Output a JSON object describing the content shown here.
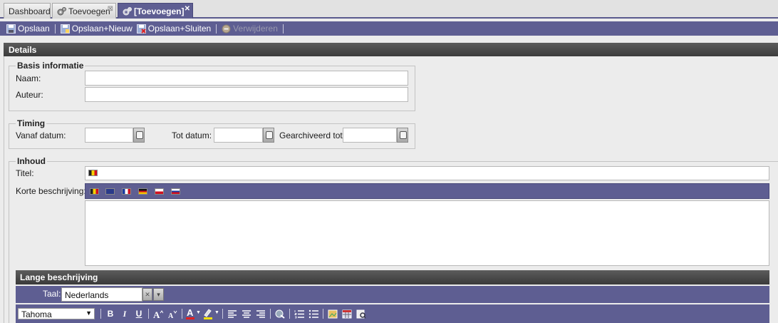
{
  "tabs": [
    {
      "label": "Dashboard",
      "closable": false,
      "active": false
    },
    {
      "label": "Toevoegen",
      "closable": true,
      "active": false
    },
    {
      "label": "[Toevoegen]",
      "closable": true,
      "active": true
    }
  ],
  "toolbar": {
    "save": "Opslaan",
    "save_new": "Opslaan+Nieuw",
    "save_close": "Opslaan+Sluiten",
    "delete": "Verwijderen"
  },
  "details": {
    "title": "Details",
    "basis": {
      "legend": "Basis informatie",
      "naam_label": "Naam:",
      "naam_value": "",
      "auteur_label": "Auteur:",
      "auteur_value": ""
    },
    "timing": {
      "legend": "Timing",
      "vanaf_label": "Vanaf datum:",
      "tot_label": "Tot datum:",
      "gearchiveerd_label": "Gearchiveerd tot:",
      "vanaf_value": "",
      "tot_value": "",
      "gearchiveerd_value": ""
    },
    "inhoud": {
      "legend": "Inhoud",
      "titel_label": "Titel:",
      "titel_value": "",
      "korte_label": "Korte beschrijving:",
      "korte_value": "",
      "flags": [
        "flag-be-icon",
        "flag-uk-icon",
        "flag-fr-icon",
        "flag-de-icon",
        "flag-cz-icon",
        "flag-sk-icon"
      ]
    }
  },
  "lange": {
    "title": "Lange beschrijving",
    "taal_label": "Taal:",
    "taal_value": "Nederlands",
    "font_value": "Tahoma",
    "bold": "B",
    "italic": "I",
    "underline": "U",
    "font_color_letter": "A"
  },
  "colors": {
    "accent": "#5e5e92",
    "header": "#4a4a4a",
    "background": "#ececec"
  }
}
